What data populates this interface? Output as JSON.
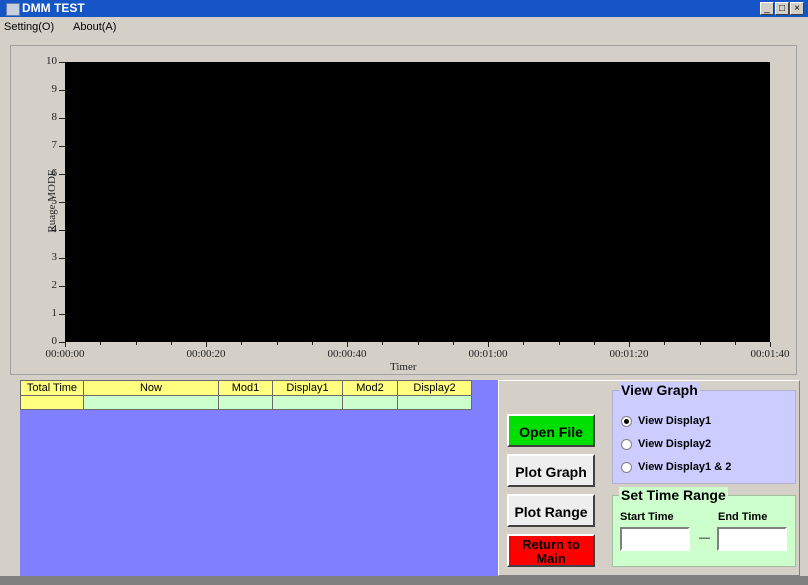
{
  "window": {
    "title": "DMM TEST",
    "buttons": [
      "_",
      "□",
      "×"
    ]
  },
  "menu": [
    {
      "label": "Setting(O)"
    },
    {
      "label": "About(A)"
    }
  ],
  "chart_data": {
    "type": "line",
    "title": "",
    "xlabel": "Timer",
    "ylabel": "Ruage MODE",
    "ylim": [
      0,
      10
    ],
    "yticks": [
      "0",
      "1",
      "2",
      "3",
      "4",
      "5",
      "6",
      "7",
      "8",
      "9",
      "10"
    ],
    "xticks": [
      "00:00:00",
      "00:00:20",
      "00:00:40",
      "00:01:00",
      "00:01:20",
      "00:01:40"
    ],
    "series": [],
    "background": "#000000"
  },
  "table": {
    "headers": [
      "Total Time",
      "Now",
      "Mod1",
      "Display1",
      "Mod2",
      "Display2"
    ],
    "rows": [
      [
        "",
        "",
        "",
        "",
        "",
        ""
      ]
    ]
  },
  "buttons": {
    "open_file": "Open File",
    "plot_graph": "Plot Graph",
    "plot_range": "Plot Range",
    "return_main": "Return to Main"
  },
  "view_graph": {
    "title": "View Graph",
    "options": [
      {
        "label": "View Display1",
        "selected": true
      },
      {
        "label": "View Display2",
        "selected": false
      },
      {
        "label": "View Display1 & 2",
        "selected": false
      }
    ]
  },
  "time_range": {
    "title": "Set Time Range",
    "start_label": "Start Time",
    "end_label": "End Time",
    "start_value": "",
    "end_value": "",
    "separator": "—"
  },
  "colors": {
    "title_bar": "#1655c6",
    "table_bg": "#7f7fff",
    "header_bg": "#ffff80",
    "row_bg": "#ccffcc",
    "open_file": "#00e000",
    "return_main": "#ff0000",
    "view_group": "#ccccff",
    "time_group": "#ccffcc"
  }
}
